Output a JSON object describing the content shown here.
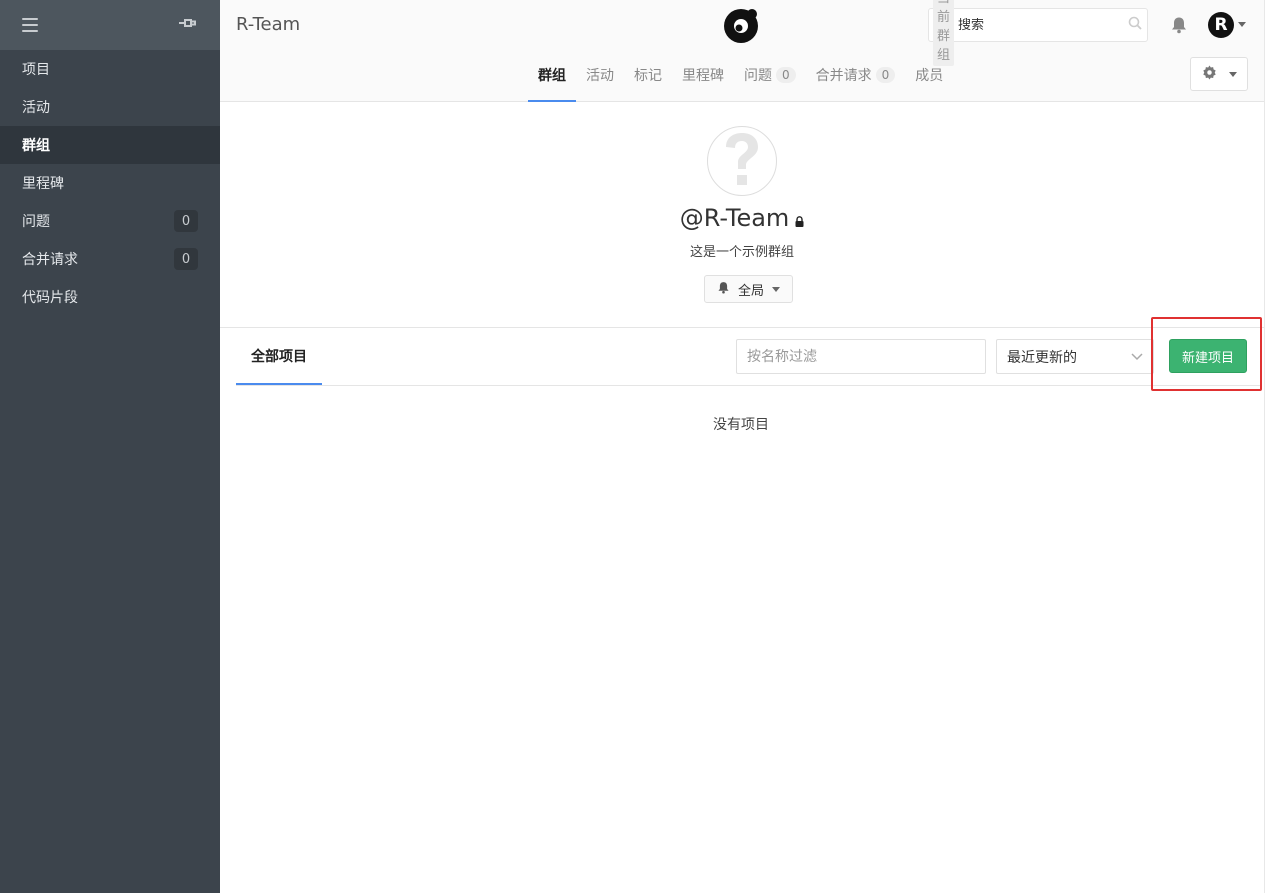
{
  "sidebar": {
    "items": [
      {
        "label": "项目",
        "count": null,
        "active": false
      },
      {
        "label": "活动",
        "count": null,
        "active": false
      },
      {
        "label": "群组",
        "count": null,
        "active": true
      },
      {
        "label": "里程碑",
        "count": null,
        "active": false
      },
      {
        "label": "问题",
        "count": "0",
        "active": false
      },
      {
        "label": "合并请求",
        "count": "0",
        "active": false
      },
      {
        "label": "代码片段",
        "count": null,
        "active": false
      }
    ]
  },
  "header": {
    "title": "R-Team",
    "search": {
      "scope": "当前群组",
      "placeholder": "搜索"
    },
    "avatar_letter": "R",
    "tabs": [
      {
        "label": "群组",
        "count": null,
        "active": true
      },
      {
        "label": "活动",
        "count": null
      },
      {
        "label": "标记",
        "count": null
      },
      {
        "label": "里程碑",
        "count": null
      },
      {
        "label": "问题",
        "count": "0"
      },
      {
        "label": "合并请求",
        "count": "0"
      },
      {
        "label": "成员",
        "count": null
      }
    ]
  },
  "group": {
    "handle": "@R-Team",
    "description": "这是一个示例群组",
    "notification_level": "全局"
  },
  "projects": {
    "tab_label": "全部项目",
    "filter_placeholder": "按名称过滤",
    "sort_value": "最近更新的",
    "new_button": "新建项目",
    "empty_text": "没有项目"
  },
  "colors": {
    "sidebar_bg": "#3c444c",
    "accent": "#4a8bee",
    "new_button": "#3cb371",
    "highlight": "#e03131"
  }
}
